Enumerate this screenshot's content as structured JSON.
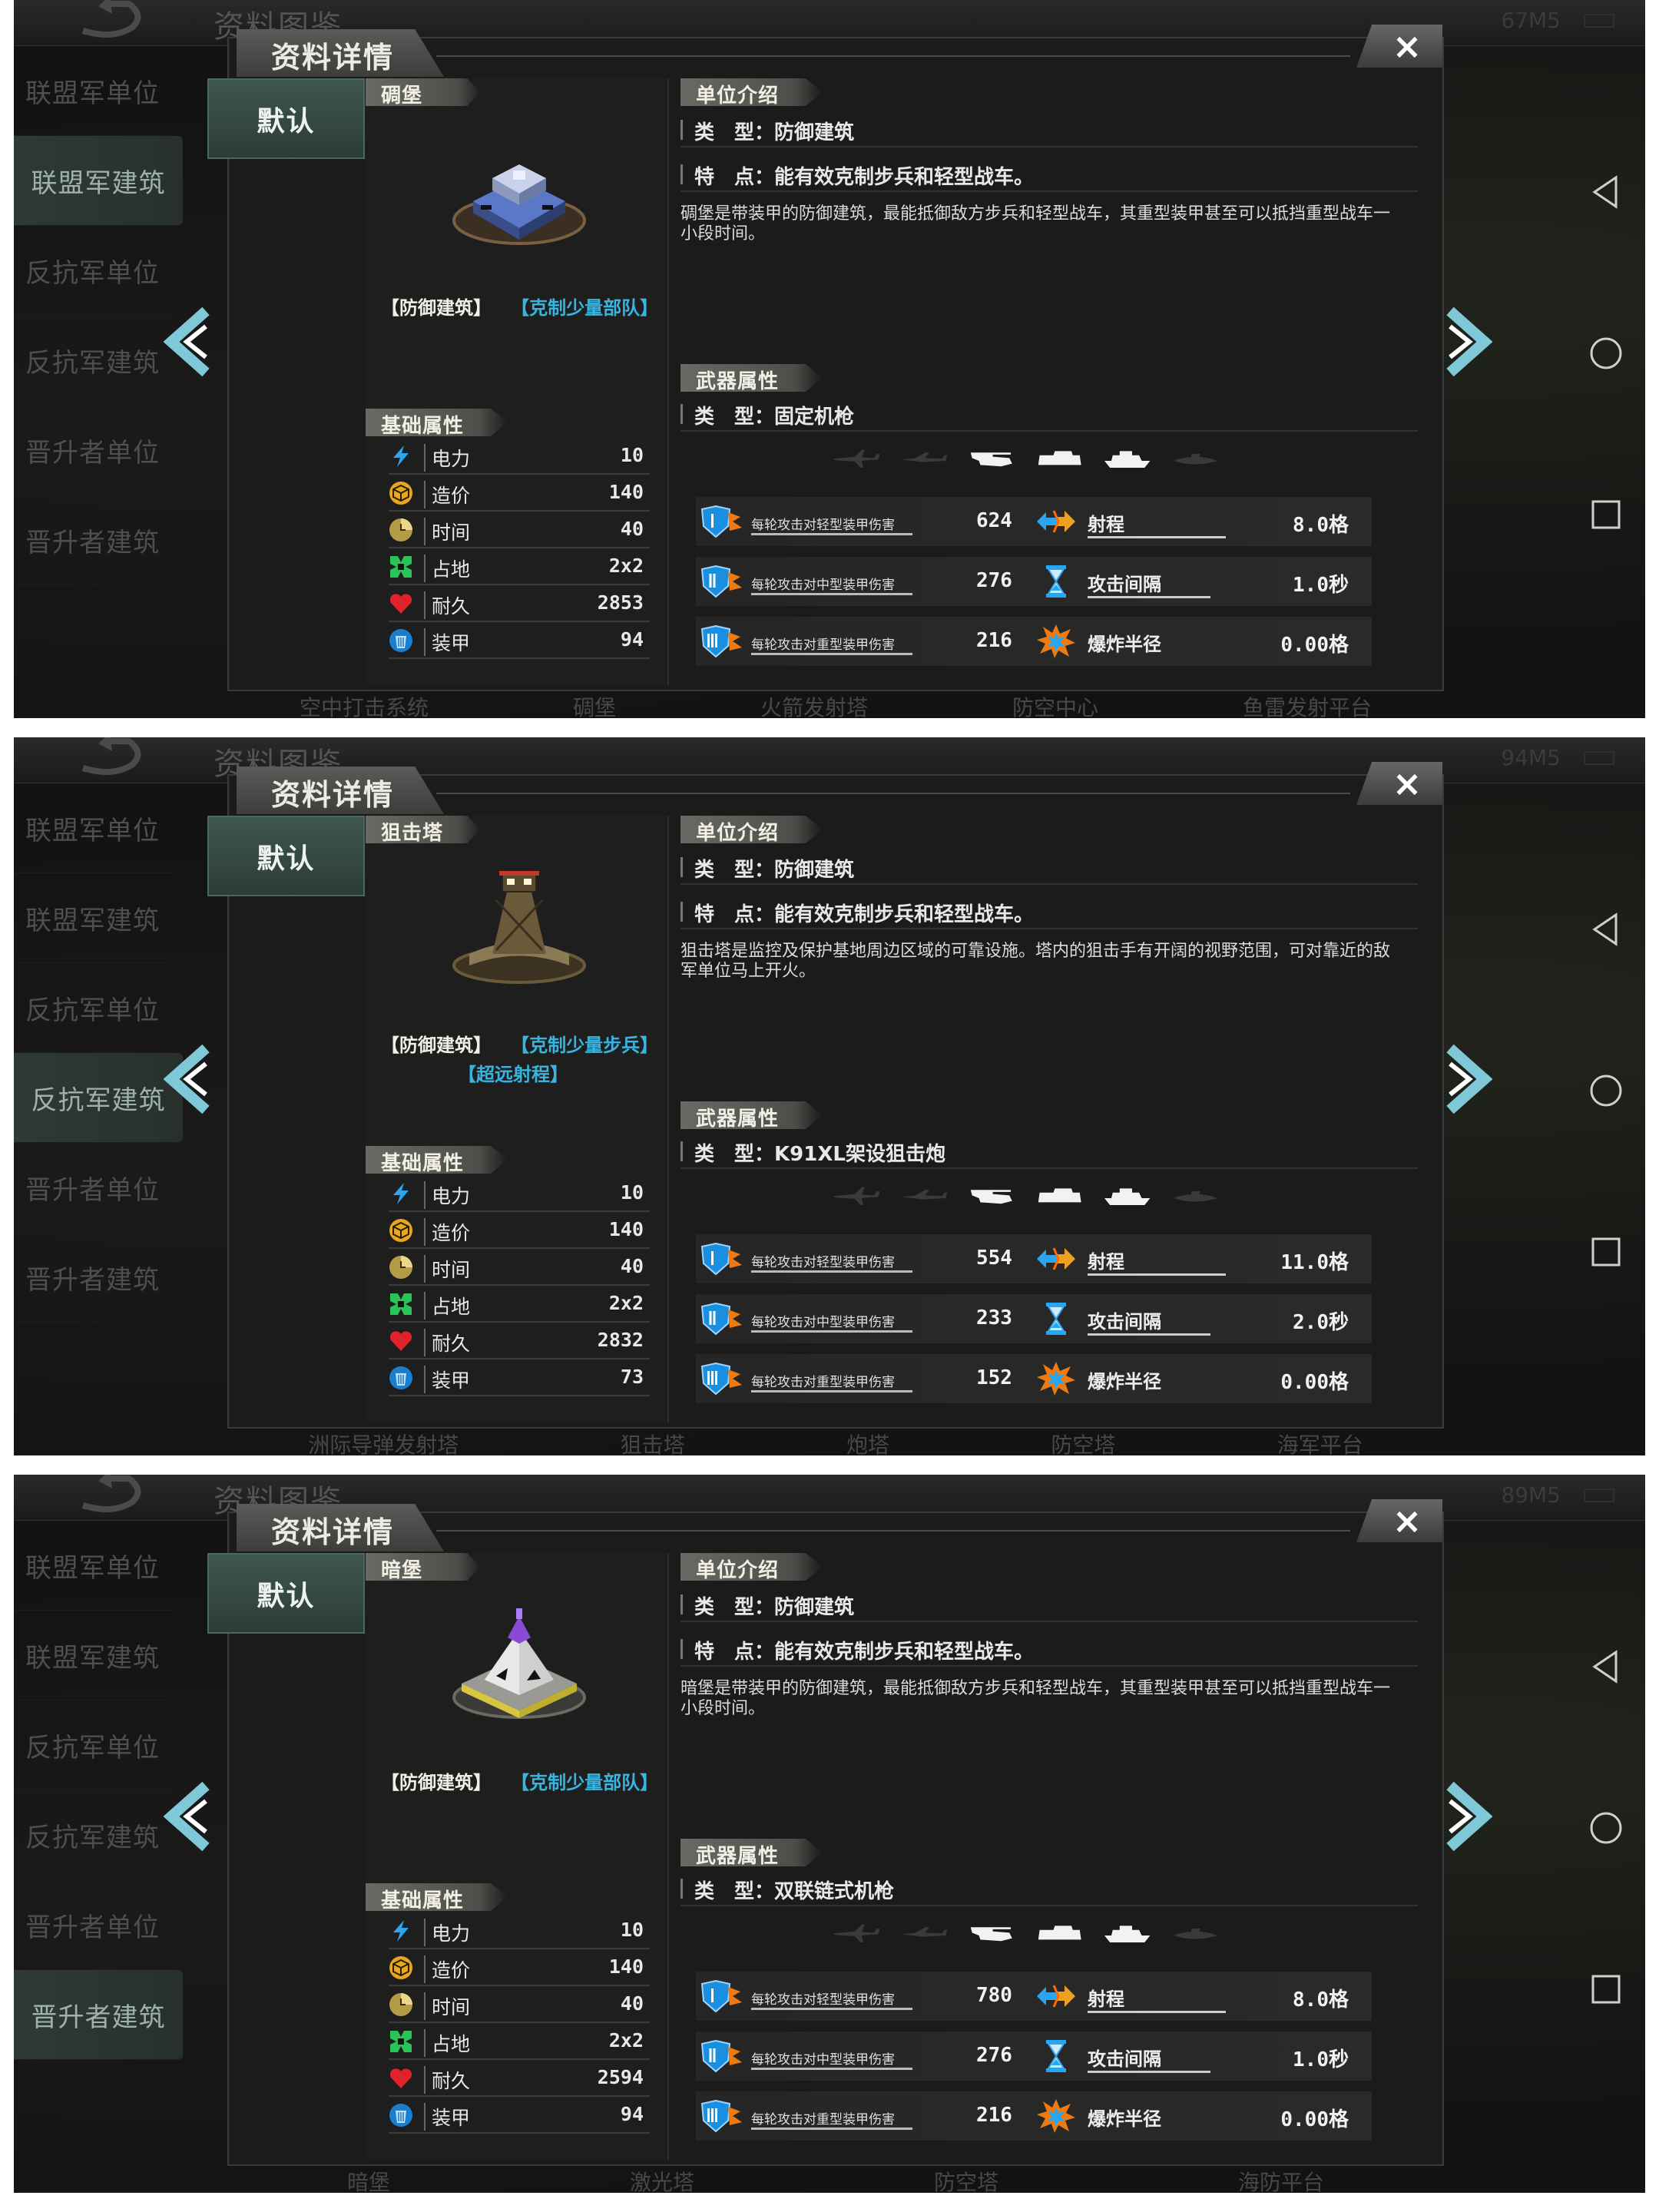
{
  "panels": [
    {
      "bg_title": "资料图鉴",
      "status": "67M5",
      "sidebar": [
        "联盟军单位",
        "联盟军建筑",
        "反抗军单位",
        "反抗军建筑",
        "晋升者单位",
        "晋升者建筑"
      ],
      "active_tab": 1,
      "dialog_title": "资料详情",
      "close_label": "×",
      "default_tab": "默认",
      "unit_name": "碉堡",
      "unit_style": "bunker",
      "tags_line1": [
        "【防御建筑】",
        "【克制少量部队】"
      ],
      "tags_line2": "",
      "basic_header": "基础属性",
      "stats": [
        {
          "label": "电力",
          "value": "10",
          "icon": "lightning-icon"
        },
        {
          "label": "造价",
          "value": "140",
          "icon": "cube-icon"
        },
        {
          "label": "时间",
          "value": "40",
          "icon": "clock-icon"
        },
        {
          "label": "占地",
          "value": "2x2",
          "icon": "footprint-icon"
        },
        {
          "label": "耐久",
          "value": "2853",
          "icon": "heart-icon"
        },
        {
          "label": "装甲",
          "value": "94",
          "icon": "armor-icon"
        }
      ],
      "intro_header": "单位介绍",
      "type_line": "类　型：防御建筑",
      "feature_line": "特　点：能有效克制步兵和轻型战车。",
      "description": "碉堡是带装甲的防御建筑，最能抵御敌方步兵和轻型战车，其重型装甲甚至可以抵挡重型战车一小段时间。",
      "weapon_header": "武器属性",
      "weapon_line": "类　型：固定机枪",
      "targets_active": [
        false,
        false,
        true,
        true,
        true,
        false
      ],
      "damage": [
        {
          "label": "每轮攻击对轻型装甲伤害",
          "value": "624",
          "attr": "射程",
          "attr_value": "8.0格",
          "attr_icon": "range-icon",
          "ul": true
        },
        {
          "label": "每轮攻击对中型装甲伤害",
          "value": "276",
          "attr": "攻击间隔",
          "attr_value": "1.0秒",
          "attr_icon": "hourglass-icon",
          "ul": true
        },
        {
          "label": "每轮攻击对重型装甲伤害",
          "value": "216",
          "attr": "爆炸半径",
          "attr_value": "0.00格",
          "attr_icon": "explosion-icon",
          "ul": false
        }
      ],
      "bottom": [
        "空中打击系统",
        "碉堡",
        "火箭发射塔",
        "防空中心",
        "鱼雷发射平台"
      ]
    },
    {
      "bg_title": "资料图鉴",
      "status": "94M5",
      "sidebar": [
        "联盟军单位",
        "联盟军建筑",
        "反抗军单位",
        "反抗军建筑",
        "晋升者单位",
        "晋升者建筑"
      ],
      "active_tab": 3,
      "dialog_title": "资料详情",
      "close_label": "×",
      "default_tab": "默认",
      "unit_name": "狙击塔",
      "unit_style": "tower",
      "tags_line1": [
        "【防御建筑】",
        "【克制少量步兵】"
      ],
      "tags_line2": "【超远射程】",
      "basic_header": "基础属性",
      "stats": [
        {
          "label": "电力",
          "value": "10",
          "icon": "lightning-icon"
        },
        {
          "label": "造价",
          "value": "140",
          "icon": "cube-icon"
        },
        {
          "label": "时间",
          "value": "40",
          "icon": "clock-icon"
        },
        {
          "label": "占地",
          "value": "2x2",
          "icon": "footprint-icon"
        },
        {
          "label": "耐久",
          "value": "2832",
          "icon": "heart-icon"
        },
        {
          "label": "装甲",
          "value": "73",
          "icon": "armor-icon"
        }
      ],
      "intro_header": "单位介绍",
      "type_line": "类　型：防御建筑",
      "feature_line": "特　点：能有效克制步兵和轻型战车。",
      "description": "狙击塔是监控及保护基地周边区域的可靠设施。塔内的狙击手有开阔的视野范围，可对靠近的敌军单位马上开火。",
      "weapon_header": "武器属性",
      "weapon_line": "类　型：K91XL架设狙击炮",
      "targets_active": [
        false,
        false,
        true,
        true,
        true,
        false
      ],
      "damage": [
        {
          "label": "每轮攻击对轻型装甲伤害",
          "value": "554",
          "attr": "射程",
          "attr_value": "11.0格",
          "attr_icon": "range-icon",
          "ul": true
        },
        {
          "label": "每轮攻击对中型装甲伤害",
          "value": "233",
          "attr": "攻击间隔",
          "attr_value": "2.0秒",
          "attr_icon": "hourglass-icon",
          "ul": true
        },
        {
          "label": "每轮攻击对重型装甲伤害",
          "value": "152",
          "attr": "爆炸半径",
          "attr_value": "0.00格",
          "attr_icon": "explosion-icon",
          "ul": false
        }
      ],
      "bottom": [
        "洲际导弹发射塔",
        "狙击塔",
        "炮塔",
        "防空塔",
        "海军平台"
      ]
    },
    {
      "bg_title": "资料图鉴",
      "status": "89M5",
      "sidebar": [
        "联盟军单位",
        "联盟军建筑",
        "反抗军单位",
        "反抗军建筑",
        "晋升者单位",
        "晋升者建筑"
      ],
      "active_tab": 5,
      "dialog_title": "资料详情",
      "close_label": "×",
      "default_tab": "默认",
      "unit_name": "暗堡",
      "unit_style": "pyramid",
      "tags_line1": [
        "【防御建筑】",
        "【克制少量部队】"
      ],
      "tags_line2": "",
      "basic_header": "基础属性",
      "stats": [
        {
          "label": "电力",
          "value": "10",
          "icon": "lightning-icon"
        },
        {
          "label": "造价",
          "value": "140",
          "icon": "cube-icon"
        },
        {
          "label": "时间",
          "value": "40",
          "icon": "clock-icon"
        },
        {
          "label": "占地",
          "value": "2x2",
          "icon": "footprint-icon"
        },
        {
          "label": "耐久",
          "value": "2594",
          "icon": "heart-icon"
        },
        {
          "label": "装甲",
          "value": "94",
          "icon": "armor-icon"
        }
      ],
      "intro_header": "单位介绍",
      "type_line": "类　型：防御建筑",
      "feature_line": "特　点：能有效克制步兵和轻型战车。",
      "description": "暗堡是带装甲的防御建筑，最能抵御敌方步兵和轻型战车，其重型装甲甚至可以抵挡重型战车一小段时间。",
      "weapon_header": "武器属性",
      "weapon_line": "类　型：双联链式机枪",
      "targets_active": [
        false,
        false,
        true,
        true,
        true,
        false
      ],
      "damage": [
        {
          "label": "每轮攻击对轻型装甲伤害",
          "value": "780",
          "attr": "射程",
          "attr_value": "8.0格",
          "attr_icon": "range-icon",
          "ul": true
        },
        {
          "label": "每轮攻击对中型装甲伤害",
          "value": "276",
          "attr": "攻击间隔",
          "attr_value": "1.0秒",
          "attr_icon": "hourglass-icon",
          "ul": true
        },
        {
          "label": "每轮攻击对重型装甲伤害",
          "value": "216",
          "attr": "爆炸半径",
          "attr_value": "0.00格",
          "attr_icon": "explosion-icon",
          "ul": false
        }
      ],
      "bottom": [
        "暗堡",
        "激光塔",
        "防空塔",
        "海防平台"
      ]
    }
  ]
}
